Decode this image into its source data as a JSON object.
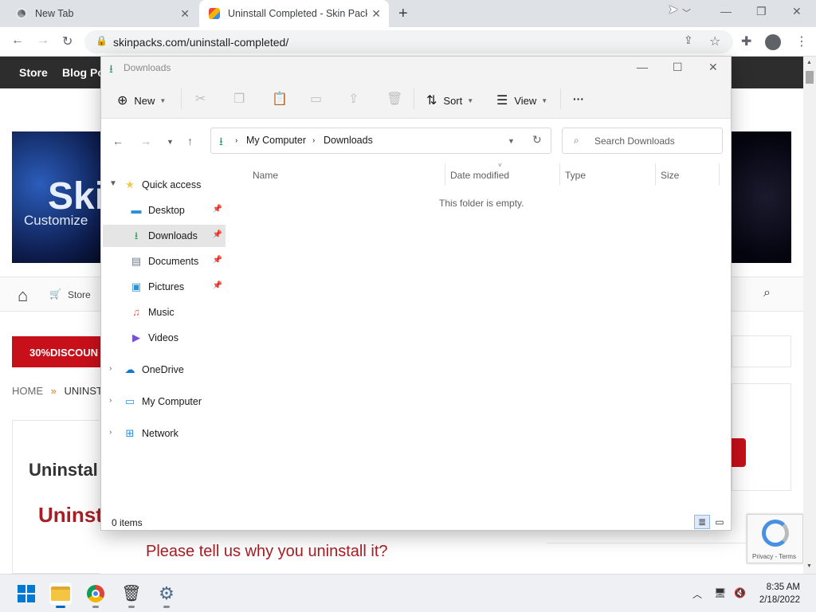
{
  "browser": {
    "tabs": [
      {
        "title": "New Tab",
        "active": false
      },
      {
        "title": "Uninstall Completed - Skin Pack",
        "active": true
      }
    ],
    "new_tab": "+",
    "url": "skinpacks.com/uninstall-completed/"
  },
  "page": {
    "nav": {
      "store": "Store",
      "blog": "Blog Po"
    },
    "banner_title": "Skin",
    "banner_sub": "Customize",
    "secnav_store": "Store",
    "discount": "30%DISCOUN",
    "breadcrumb": {
      "home": "HOME",
      "sep": "»",
      "current": "UNINST"
    },
    "heading": "Uninstal",
    "heading2": "Uninst",
    "please": "Please tell us why you uninstall it?",
    "recaptcha": "Privacy - Terms"
  },
  "explorer": {
    "title": "Downloads",
    "commands": {
      "new": "New",
      "sort": "Sort",
      "view": "View",
      "more": "···"
    },
    "path": [
      "My Computer",
      "Downloads"
    ],
    "search_placeholder": "Search Downloads",
    "columns": [
      "Name",
      "Date modified",
      "Type",
      "Size"
    ],
    "empty_message": "This folder is empty.",
    "status": "0 items",
    "sidebar": [
      {
        "label": "Quick access",
        "icon": "star-icon",
        "top": true,
        "expanded": true
      },
      {
        "label": "Desktop",
        "icon": "desktop-icon",
        "pinned": true
      },
      {
        "label": "Downloads",
        "icon": "download-icon",
        "pinned": true,
        "selected": true
      },
      {
        "label": "Documents",
        "icon": "document-icon",
        "pinned": true
      },
      {
        "label": "Pictures",
        "icon": "pictures-icon",
        "pinned": true
      },
      {
        "label": "Music",
        "icon": "music-icon"
      },
      {
        "label": "Videos",
        "icon": "videos-icon"
      },
      {
        "label": "OneDrive",
        "icon": "cloud-icon",
        "top": true
      },
      {
        "label": "My Computer",
        "icon": "computer-icon",
        "top": true
      },
      {
        "label": "Network",
        "icon": "network-icon",
        "top": true
      }
    ]
  },
  "taskbar": {
    "time": "8:35 AM",
    "date": "2/18/2022"
  },
  "colors": {
    "accent": "#0067c0",
    "brand_red": "#c8101b",
    "heading_red": "#a71e24",
    "downloads_green": "#1e9f58"
  }
}
